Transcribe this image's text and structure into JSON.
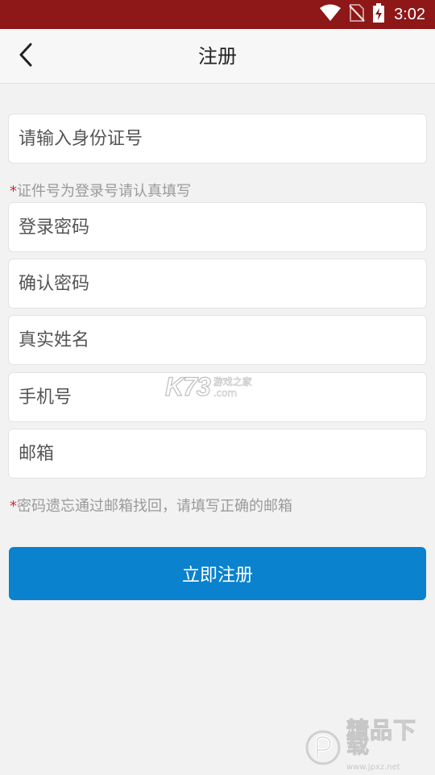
{
  "status_bar": {
    "time": "3:02",
    "icons": [
      "wifi-icon",
      "no-sim-icon",
      "battery-charging-icon"
    ],
    "background_color": "#8e1717"
  },
  "header": {
    "title": "注册",
    "back_icon": "chevron-left-icon"
  },
  "form": {
    "id_number": {
      "value": "",
      "placeholder": "请输入身份证号"
    },
    "id_note": {
      "marker": "*",
      "text": "证件号为登录号请认真填写"
    },
    "password": {
      "value": "",
      "placeholder": "登录密码"
    },
    "confirm_password": {
      "value": "",
      "placeholder": "确认密码"
    },
    "real_name": {
      "value": "",
      "placeholder": "真实姓名"
    },
    "phone": {
      "value": "",
      "placeholder": "手机号"
    },
    "email": {
      "value": "",
      "placeholder": "邮箱"
    },
    "email_note": {
      "marker": "*",
      "text": "密码遗忘通过邮箱找回，请填写正确的邮箱"
    },
    "submit_label": "立即注册",
    "accent_color": "#0a82cd"
  },
  "watermarks": {
    "k73": {
      "logo": "K73",
      "cn": "游戏之家",
      "domain": ".com"
    },
    "corner": {
      "text": "精品下载",
      "url": "www.jpxz.net"
    }
  }
}
